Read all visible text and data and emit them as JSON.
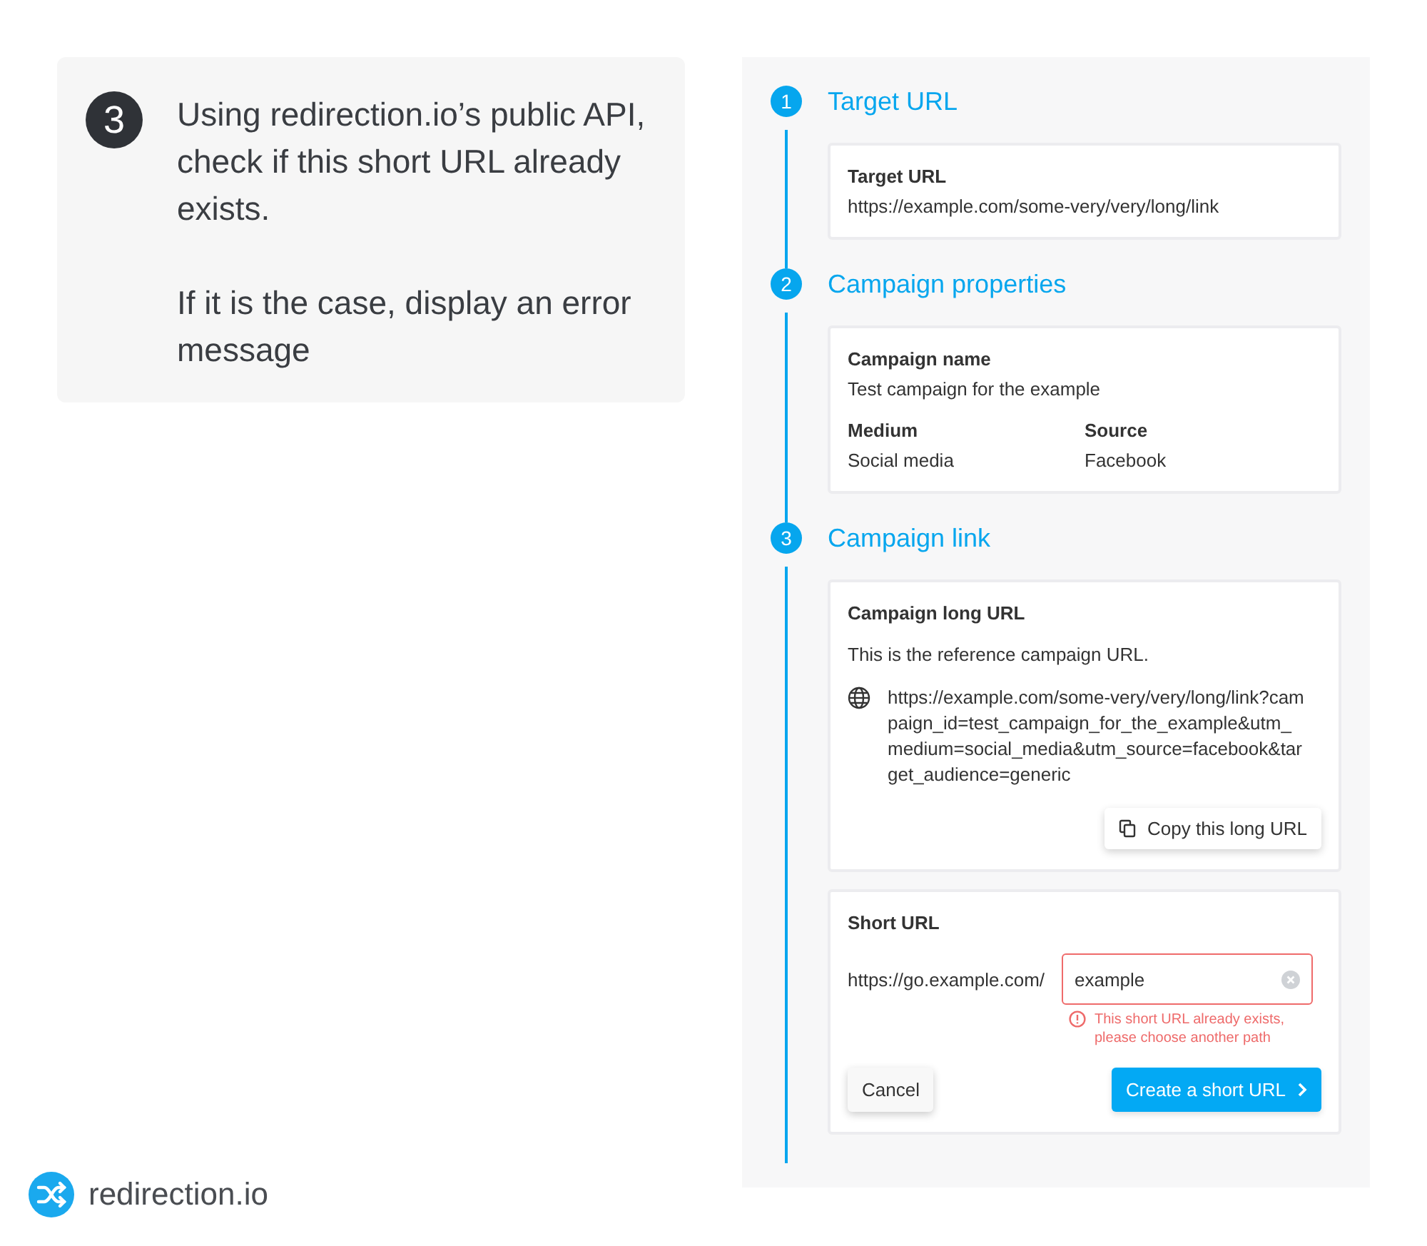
{
  "intro": {
    "step": "3",
    "paragraphs": [
      "Using redirection.io’s public API, check if this short URL already exists.",
      "If it is the case, display an error message"
    ]
  },
  "steps": [
    {
      "number": "1",
      "title": "Target URL",
      "cards": [
        {
          "kind": "fields",
          "rows": [
            [
              {
                "label": "Target URL",
                "value": "https://example.com/some-very/very/long/link"
              }
            ]
          ]
        }
      ]
    },
    {
      "number": "2",
      "title": "Campaign properties",
      "cards": [
        {
          "kind": "fields",
          "rows": [
            [
              {
                "label": "Campaign name",
                "value": "Test campaign for the example"
              }
            ],
            [
              {
                "label": "Medium",
                "value": "Social media"
              },
              {
                "label": "Source",
                "value": "Facebook"
              }
            ]
          ]
        }
      ]
    },
    {
      "number": "3",
      "title": "Campaign link",
      "cards": [
        {
          "kind": "long_url",
          "title": "Campaign long URL",
          "description": "This is the reference campaign URL.",
          "url": "https://example.com/some-very/very/long/link?campaign_id=test_campaign_for_the_example&utm_medium=social_media&utm_source=facebook&target_audience=generic",
          "copy_button": "Copy this long URL"
        },
        {
          "kind": "short_url",
          "title": "Short URL",
          "prefix": "https://go.example.com/",
          "value": "example",
          "invalid": true,
          "error": "This short URL already exists, please choose another path",
          "cancel": "Cancel",
          "submit": "Create a short URL"
        }
      ]
    }
  ],
  "logo": {
    "name": "redirection.io"
  }
}
